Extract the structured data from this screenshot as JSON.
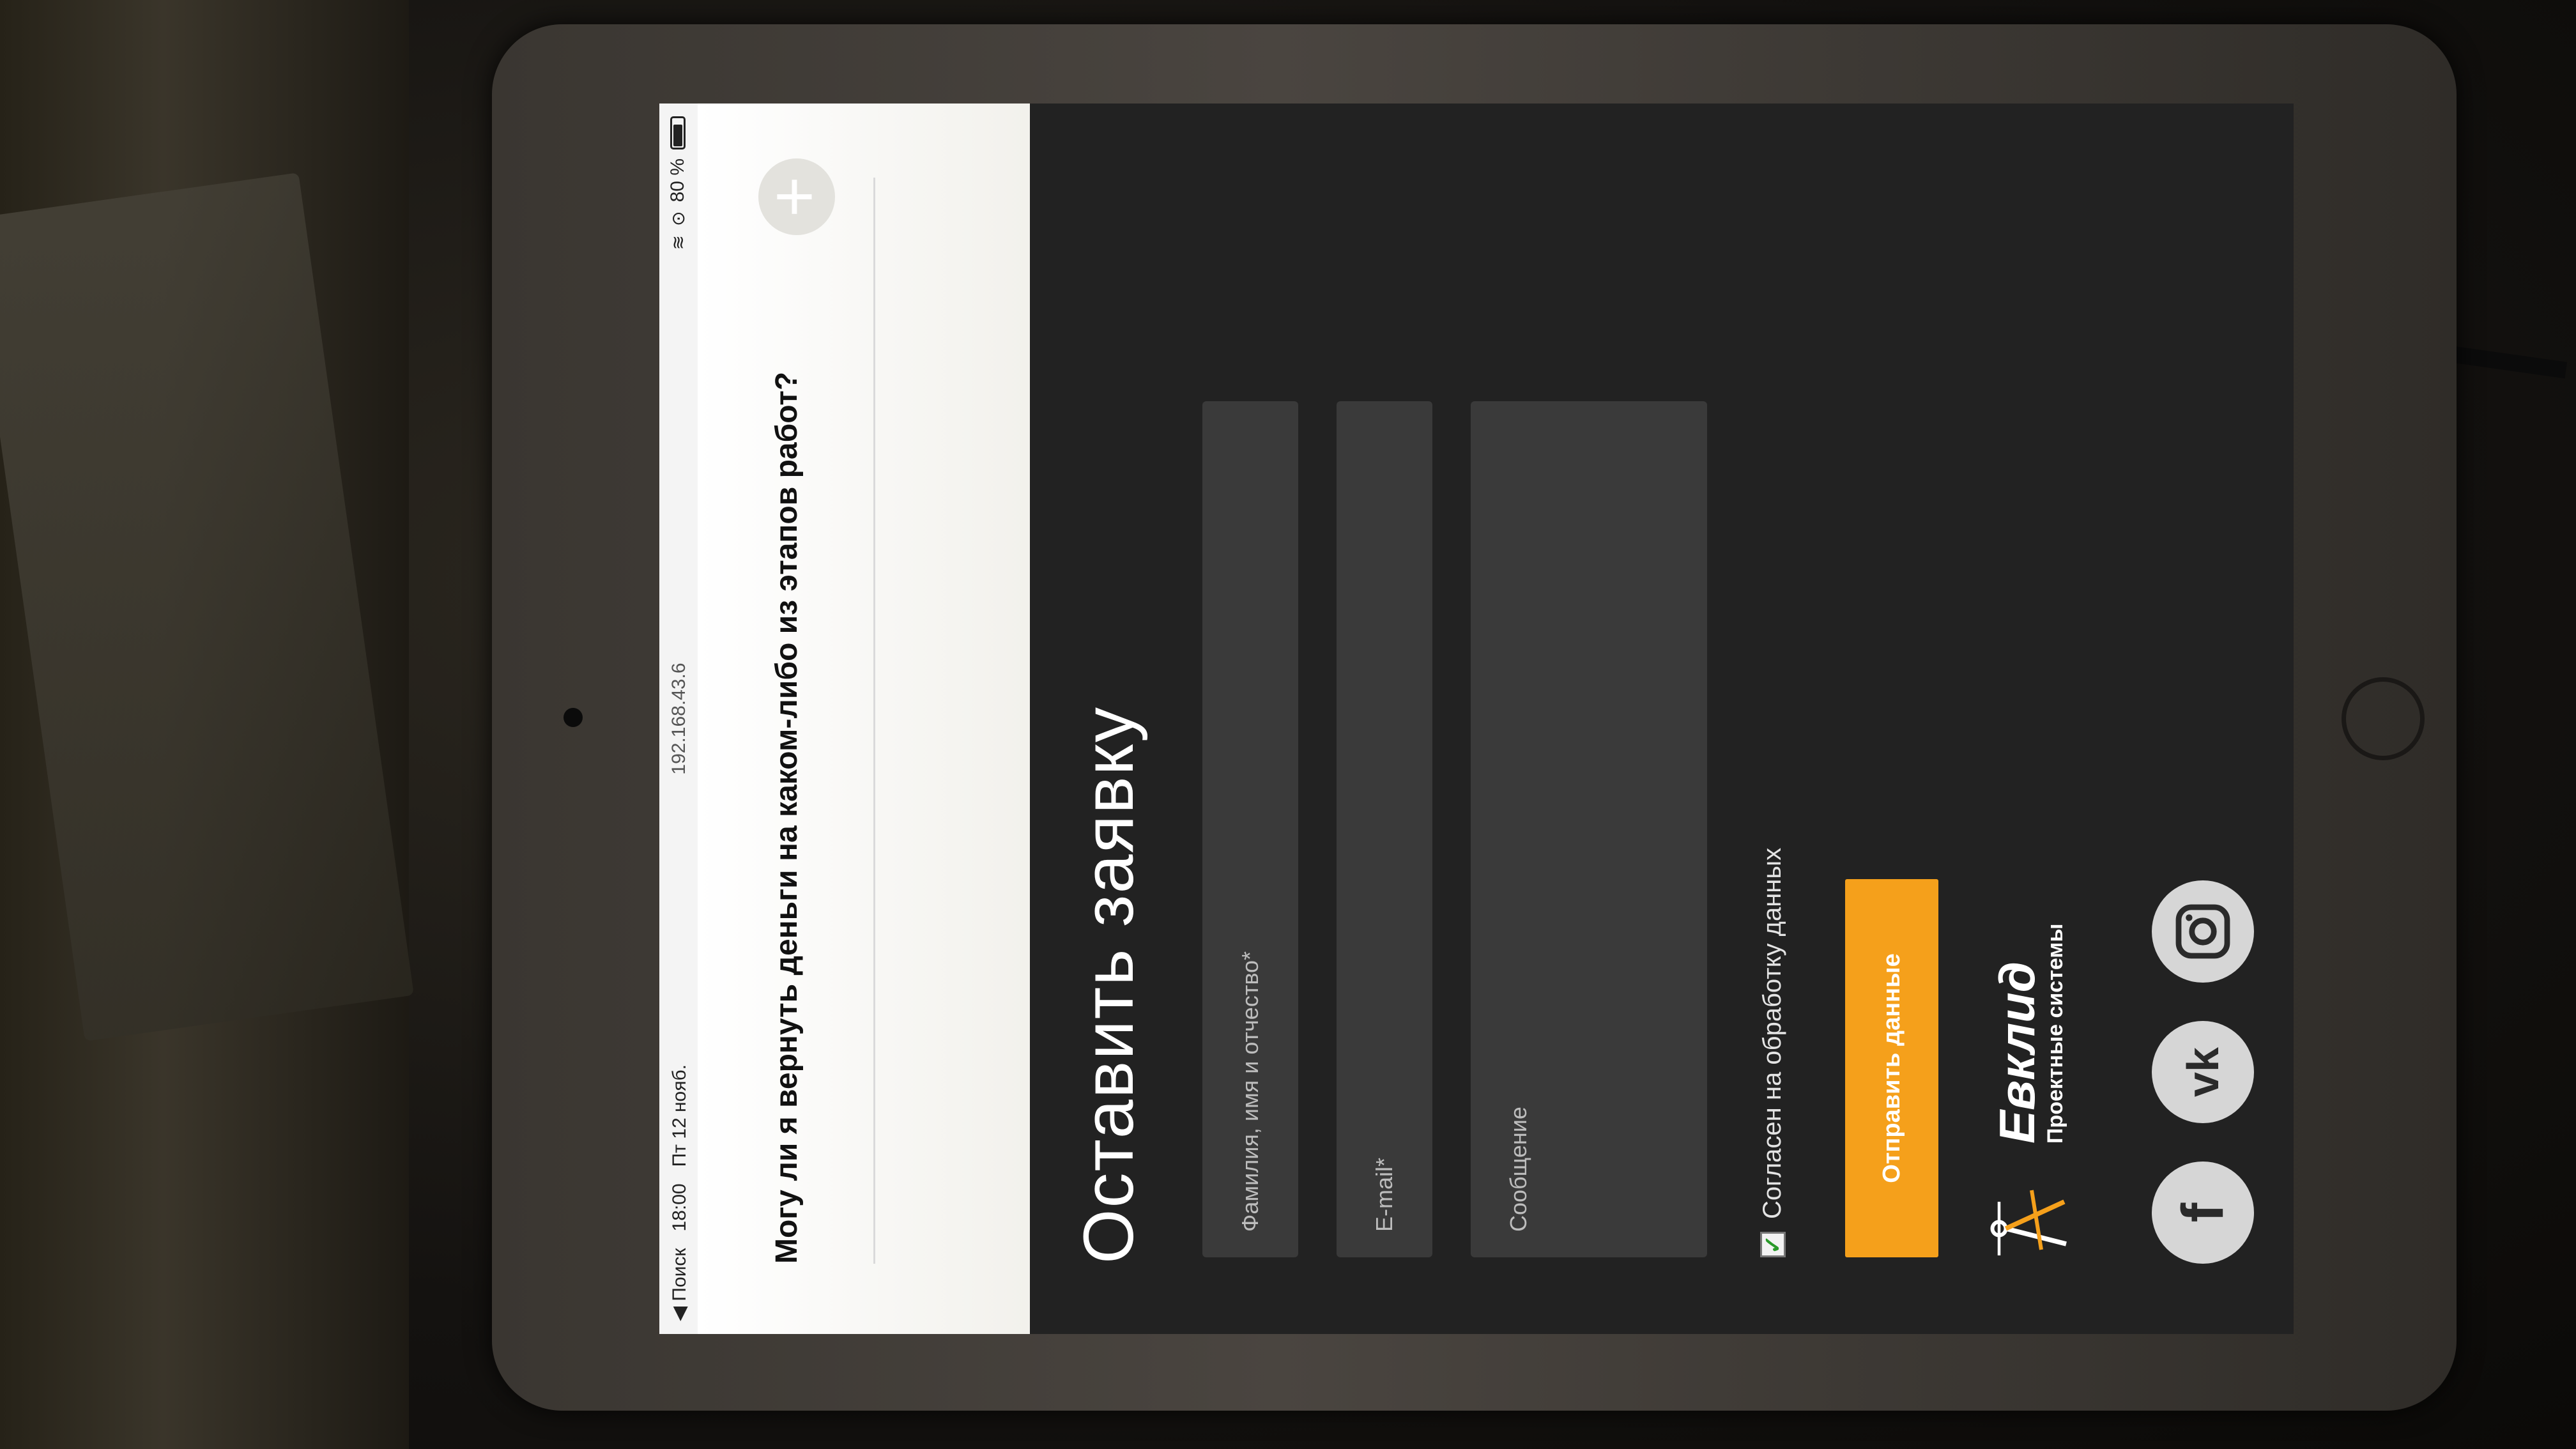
{
  "status_bar": {
    "back_label": "◀ Поиск",
    "time": "18:00",
    "date": "Пт 12 нояб.",
    "address": "192.168.43.6",
    "battery_percent": "80 %"
  },
  "question": {
    "text": "Могу ли я вернуть деньги на каком-либо из этапов работ?",
    "expand_symbol": "+"
  },
  "form": {
    "title": "Оставить заявку",
    "name_placeholder": "Фамилия, имя и отчество*",
    "email_placeholder": "E-mail*",
    "message_placeholder": "Сообщение",
    "consent_label": "Согласен на обработку данных",
    "consent_checked": true,
    "submit_label": "Отправить данные",
    "submit_color": "#f5a01b"
  },
  "brand": {
    "name": "Евклид",
    "tagline": "Проектные системы",
    "logo_icon": "compass-icon"
  },
  "socials": [
    {
      "name": "facebook",
      "icon": "facebook-icon",
      "glyph": "f"
    },
    {
      "name": "vk",
      "icon": "vk-icon",
      "glyph": "vk"
    },
    {
      "name": "instagram",
      "icon": "instagram-icon",
      "glyph": ""
    }
  ]
}
